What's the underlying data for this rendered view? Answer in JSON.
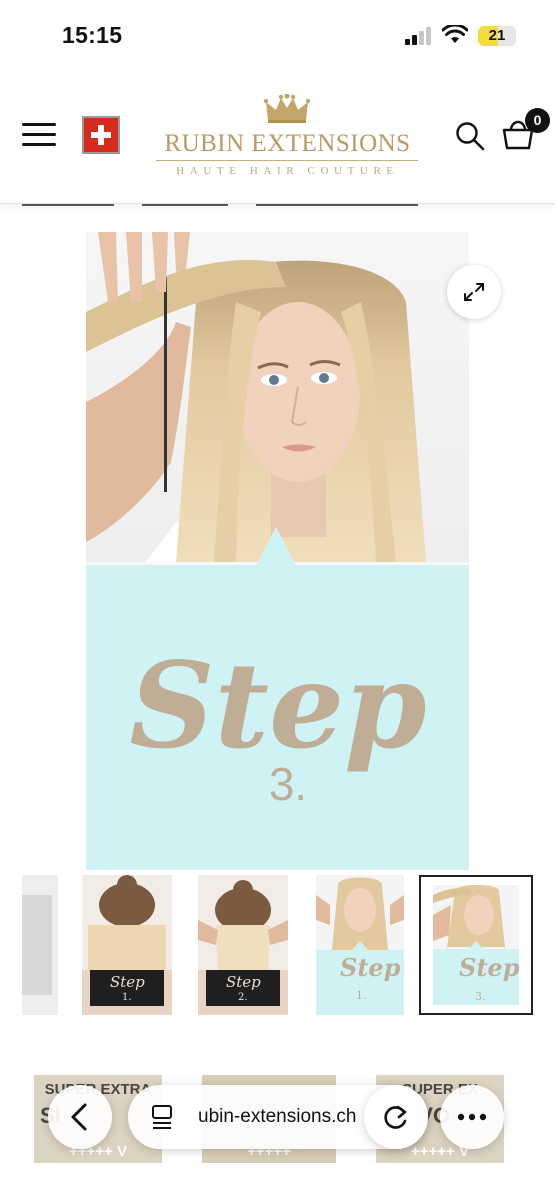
{
  "status_bar": {
    "time": "15:15",
    "battery": "21",
    "battery_level": 0.21
  },
  "header": {
    "brand_name": "RUBIN EXTENSIONS",
    "brand_tagline": "HAUTE HAIR COUTURE",
    "cart_count": "0",
    "icons": [
      "hamburger-menu-icon",
      "swiss-flag-icon",
      "crown-icon",
      "search-icon",
      "shopping-bag-icon"
    ]
  },
  "gallery": {
    "main_step_word": "Step",
    "main_step_number": "3.",
    "thumbnails": [
      {
        "word": "",
        "number": ""
      },
      {
        "word": "Step",
        "number": "1."
      },
      {
        "word": "Step",
        "number": "2."
      },
      {
        "word": "Step",
        "number": "1."
      },
      {
        "word": "Step",
        "number": "3."
      }
    ],
    "colors": {
      "step_panel": "#cff3f5",
      "step_text": "#bfae95",
      "dark_panel": "#1f1f1f"
    }
  },
  "products": [
    {
      "line1": "SUPER EXTRA",
      "line2": "SI",
      "stars": "+++++ V"
    },
    {
      "line1": "",
      "line2": "",
      "stars": "+++++"
    },
    {
      "line1": "SUPER EX",
      "line2": "VO",
      "stars": "+++++ V"
    }
  ],
  "browser": {
    "url": "ubin-extensions.ch"
  },
  "accent_color": "#b99a62"
}
